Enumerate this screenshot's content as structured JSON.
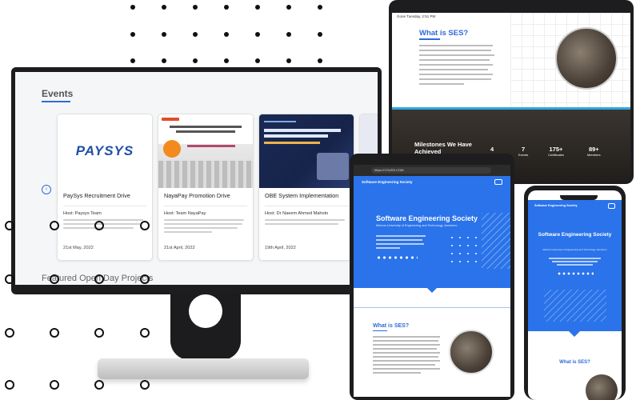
{
  "monitor": {
    "section_title": "Events",
    "featured_title": "Featured Open Day Projects",
    "cards": [
      {
        "logo": "PAYSYS",
        "title": "PaySys Recruitment Drive",
        "host": "Host: Paysys Team",
        "date": "21st May, 2022"
      },
      {
        "title": "NayaPay Promotion Drive",
        "host": "Host: Team NayaPay",
        "date": "21st April, 2022"
      },
      {
        "title": "OBE System Implementation",
        "host": "Host: Dr Naeem Ahmed Mahoto",
        "date": "19th April, 2022"
      }
    ]
  },
  "tablet_top": {
    "status": "Gone Tuesday, 2:51 PM",
    "heading": "What is SES?",
    "milestones": "Milestones We Have Achieved",
    "stats": [
      {
        "n": "4",
        "l": "Tenures"
      },
      {
        "n": "7",
        "l": "Events"
      },
      {
        "n": "175+",
        "l": "Certificates"
      },
      {
        "n": "89+",
        "l": "Members"
      }
    ]
  },
  "tablet_mid": {
    "url": "https://YOUSS.COM",
    "nav": "Software Engineering Society",
    "title": "Software Engineering Society",
    "subtitle": "Mehran University of Engineering and Technology Jamshoro",
    "what": "What is SES?"
  },
  "phone": {
    "nav": "Software Engineering Society",
    "title": "Software Engineering Society",
    "subtitle": "Mehran University of Engineering and Technology Jamshoro",
    "what": "What is SES?"
  }
}
